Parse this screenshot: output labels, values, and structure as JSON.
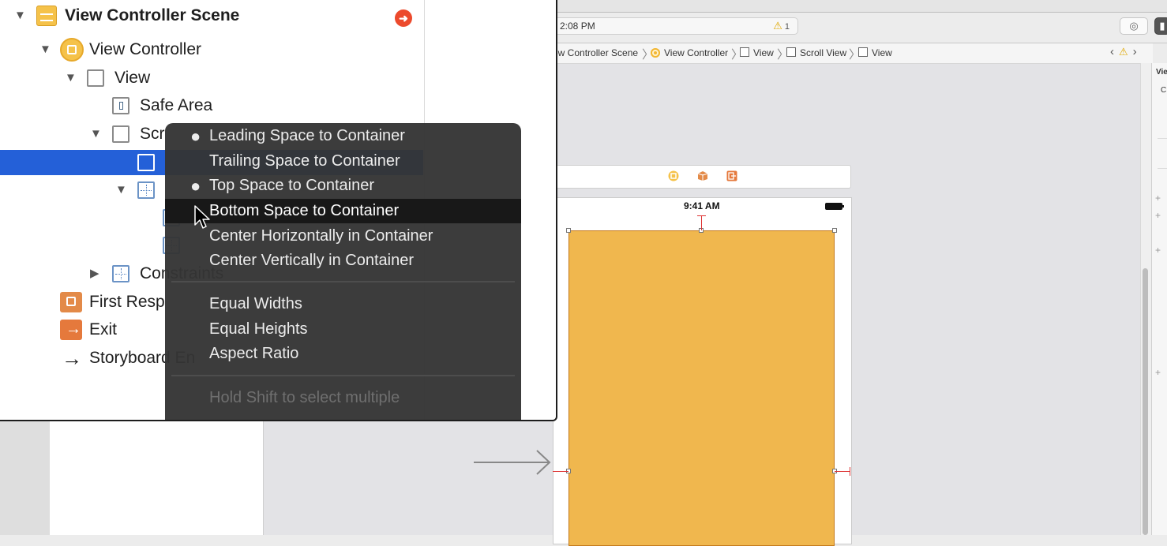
{
  "toolbar": {
    "activity_time": "2:08 PM",
    "warning_count": "1"
  },
  "jumpbar": {
    "crumbs": [
      "ew Controller Scene",
      "View Controller",
      "View",
      "Scroll View",
      "View"
    ]
  },
  "canvas": {
    "status_time": "9:41 AM",
    "view_color": "#f0b74e"
  },
  "inspector": {
    "label_1": "Vie",
    "label_2": "C"
  },
  "outline": {
    "scene_title": "View Controller Scene",
    "view_controller": "View Controller",
    "view": "View",
    "safe_area": "Safe Area",
    "scroll_view_partial": "Scr",
    "constraints_partial": "Constraints",
    "first_responder_partial": "First Resp",
    "exit": "Exit",
    "storyboard_partial": "Storyboard En"
  },
  "context_menu": {
    "items": [
      {
        "label": "Leading Space to Container",
        "bullet": "●"
      },
      {
        "label": "Trailing Space to Container",
        "bullet": ""
      },
      {
        "label": "Top Space to Container",
        "bullet": "●"
      },
      {
        "label": "Bottom Space to Container",
        "bullet": ""
      },
      {
        "label": "Center Horizontally in Container",
        "bullet": ""
      },
      {
        "label": "Center Vertically in Container",
        "bullet": ""
      },
      {
        "label": "Equal Widths",
        "bullet": ""
      },
      {
        "label": "Equal Heights",
        "bullet": ""
      },
      {
        "label": "Aspect Ratio",
        "bullet": ""
      },
      {
        "label": "Hold Shift to select multiple",
        "bullet": ""
      }
    ],
    "highlighted_index": 3
  },
  "colors": {
    "selection": "#2460d8",
    "menu_bg": "#343434",
    "accent_orange": "#f0b74e"
  }
}
